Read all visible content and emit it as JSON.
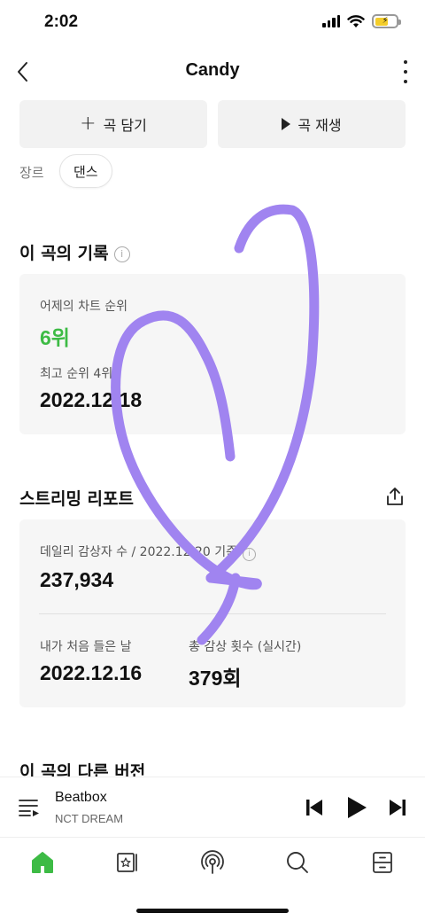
{
  "status": {
    "time": "2:02"
  },
  "header": {
    "title": "Candy"
  },
  "actions": {
    "add_label": "곡 담기",
    "play_label": "곡 재생"
  },
  "genre": {
    "label": "장르",
    "value": "댄스"
  },
  "record": {
    "title": "이 곡의 기록",
    "yesterday_label": "어제의 차트 순위",
    "yesterday_rank": "6위",
    "best_label": "최고 순위 4위",
    "best_date": "2022.12.18"
  },
  "streaming": {
    "title": "스트리밍 리포트",
    "daily_label": "데일리 감상자 수 / 2022.12.20 기준",
    "daily_value": "237,934",
    "first_label": "내가 처음 들은 날",
    "first_value": "2022.12.16",
    "total_label": "총 감상 횟수 (실시간)",
    "total_value": "379회"
  },
  "other_versions": {
    "title": "이 곡의 다른 버전"
  },
  "player": {
    "track": "Beatbox",
    "artist": "NCT DREAM"
  },
  "colors": {
    "accent": "#3dbb45",
    "scribble": "#a084f0"
  }
}
